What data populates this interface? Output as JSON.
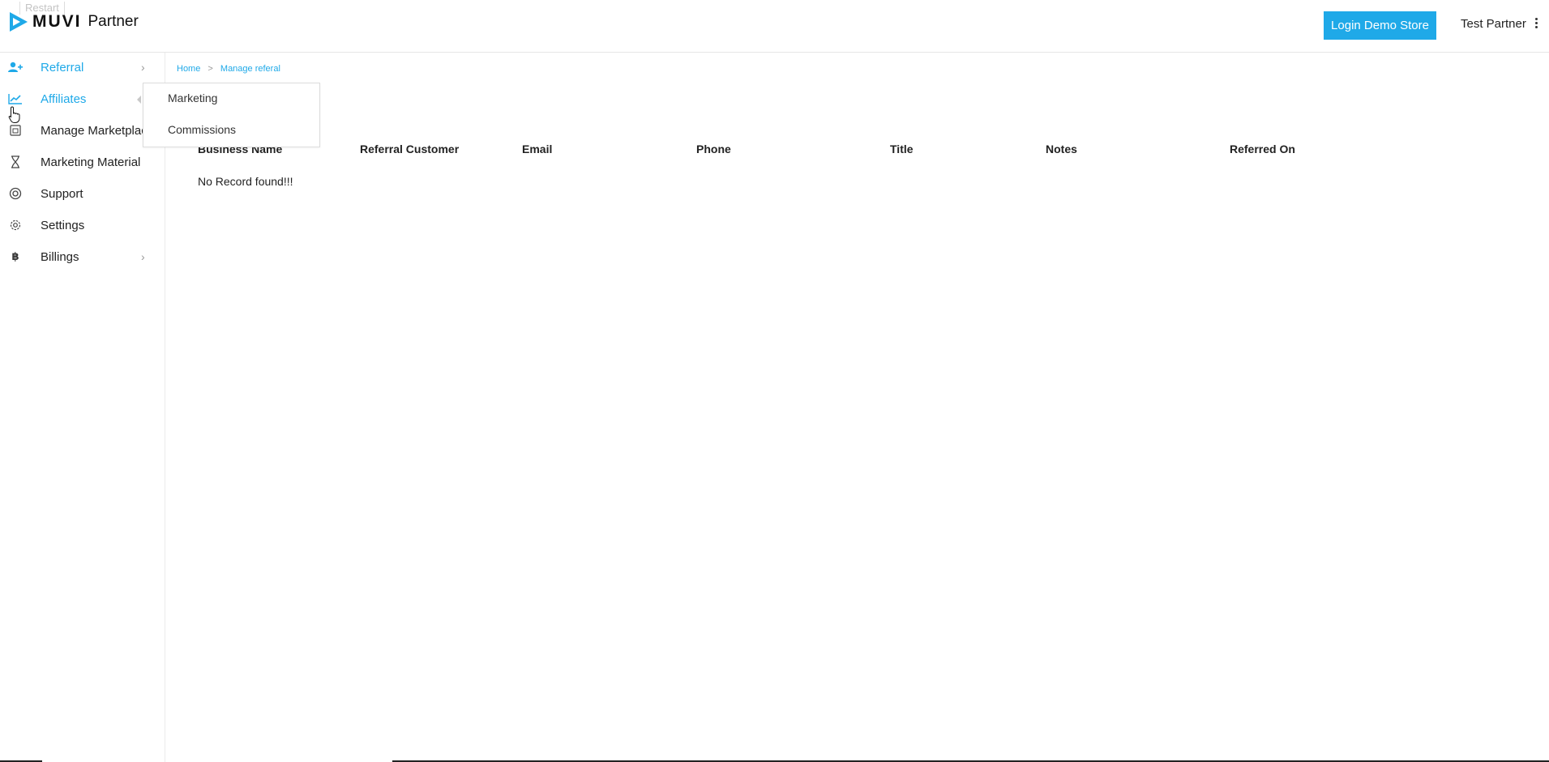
{
  "header": {
    "restart_label": "Restart",
    "logo_text": "MUVI",
    "logo_suffix": "Partner",
    "demo_button": "Login Demo Store",
    "user_name": "Test Partner",
    "accent_color": "#1fa9e8"
  },
  "sidebar": {
    "items": [
      {
        "label": "Referral",
        "icon": "add-user-icon",
        "active": true,
        "has_chevron": true
      },
      {
        "label": "Affiliates",
        "icon": "trend-chart-icon",
        "active": true,
        "has_chevron": false
      },
      {
        "label": "Manage Marketplace",
        "icon": "marketplace-icon",
        "active": false,
        "has_chevron": false
      },
      {
        "label": "Marketing Material",
        "icon": "hourglass-icon",
        "active": false,
        "has_chevron": false
      },
      {
        "label": "Support",
        "icon": "lifebuoy-icon",
        "active": false,
        "has_chevron": false
      },
      {
        "label": "Settings",
        "icon": "gear-icon",
        "active": false,
        "has_chevron": false
      },
      {
        "label": "Billings",
        "icon": "bitcoin-icon",
        "active": false,
        "has_chevron": true
      }
    ]
  },
  "flyout": {
    "items": [
      "Marketing",
      "Commissions"
    ]
  },
  "breadcrumb": {
    "home": "Home",
    "separator": ">",
    "current": "Manage referal"
  },
  "table": {
    "columns": [
      "Business Name",
      "Referral Customer",
      "Email",
      "Phone",
      "Title",
      "Notes",
      "Referred On"
    ],
    "empty_message": "No Record found!!!"
  }
}
